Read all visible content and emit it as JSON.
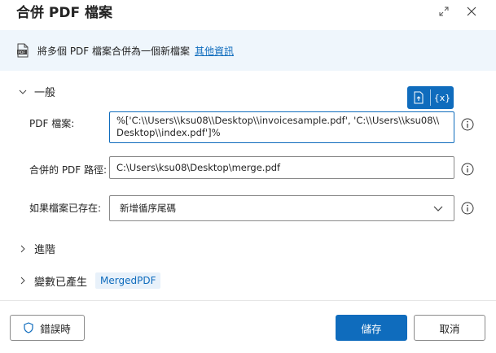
{
  "dialog": {
    "title": "合併 PDF 檔案"
  },
  "info_bar": {
    "description": "將多個 PDF 檔案合併為一個新檔案",
    "link_text": "其他資訊"
  },
  "sections": {
    "general": "一般",
    "advanced": "進階",
    "variables_produced": "變數已產生"
  },
  "fields": {
    "pdf_files": {
      "label": "PDF 檔案:",
      "value_line1": "%['C:\\\\Users\\\\ksu08\\\\Desktop\\\\invoicesample.pdf', 'C:\\\\Users\\\\ksu08\\\\",
      "value_line2": "Desktop\\\\index.pdf']%"
    },
    "merged_path": {
      "label": "合併的 PDF 路徑:",
      "value": "C:\\Users\\ksu08\\Desktop\\merge.pdf"
    },
    "if_exists": {
      "label": "如果檔案已存在:",
      "selected": "新增循序尾碼"
    }
  },
  "toolbar": {
    "variable_button": "{x}"
  },
  "variables": {
    "produced": [
      "MergedPDF"
    ]
  },
  "buttons": {
    "on_error": "錯誤時",
    "save": "儲存",
    "cancel": "取消"
  },
  "colors": {
    "accent": "#0f6cbd",
    "info_bar_bg": "#eff6fc",
    "chip_bg": "#e8f1fa"
  }
}
